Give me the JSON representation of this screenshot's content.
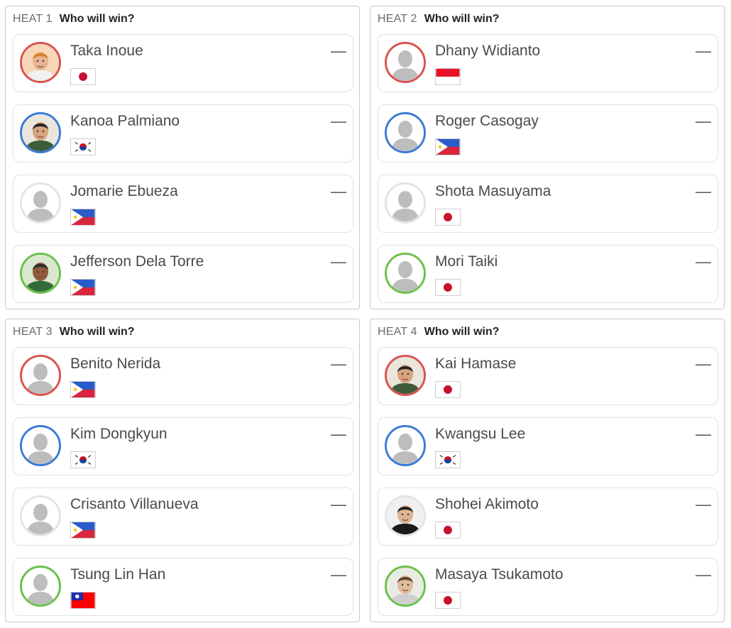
{
  "heats": [
    {
      "label": "HEAT 1",
      "question": "Who will win?",
      "surfers": [
        {
          "name": "Taka Inoue",
          "flag": "japan",
          "ring": "#d9534f",
          "photo": "orange-hair-face",
          "score": "—"
        },
        {
          "name": "Kanoa Palmiano",
          "flag": "korea",
          "ring": "#3a7bd5",
          "photo": "dark-hair-face",
          "score": "—"
        },
        {
          "name": "Jomarie Ebueza",
          "flag": "philippines",
          "ring": "#e4e4e4",
          "photo": "placeholder",
          "score": "—"
        },
        {
          "name": "Jefferson Dela Torre",
          "flag": "philippines",
          "ring": "#6cc04a",
          "photo": "dark-skin-face",
          "score": "—"
        }
      ]
    },
    {
      "label": "HEAT 2",
      "question": "Who will win?",
      "surfers": [
        {
          "name": "Dhany Widianto",
          "flag": "indonesia",
          "ring": "#d9534f",
          "photo": "placeholder",
          "score": "—"
        },
        {
          "name": "Roger Casogay",
          "flag": "philippines",
          "ring": "#3a7bd5",
          "photo": "placeholder",
          "score": "—"
        },
        {
          "name": "Shota Masuyama",
          "flag": "japan",
          "ring": "#e4e4e4",
          "photo": "placeholder",
          "score": "—"
        },
        {
          "name": "Mori Taiki",
          "flag": "japan",
          "ring": "#6cc04a",
          "photo": "placeholder",
          "score": "—"
        }
      ]
    },
    {
      "label": "HEAT 3",
      "question": "Who will win?",
      "surfers": [
        {
          "name": "Benito Nerida",
          "flag": "philippines",
          "ring": "#d9534f",
          "photo": "placeholder",
          "score": "—"
        },
        {
          "name": "Kim Dongkyun",
          "flag": "korea",
          "ring": "#3a7bd5",
          "photo": "placeholder",
          "score": "—"
        },
        {
          "name": "Crisanto Villanueva",
          "flag": "philippines",
          "ring": "#e4e4e4",
          "photo": "placeholder",
          "score": "—"
        },
        {
          "name": "Tsung Lin Han",
          "flag": "taiwan",
          "ring": "#6cc04a",
          "photo": "placeholder",
          "score": "—"
        }
      ]
    },
    {
      "label": "HEAT 4",
      "question": "Who will win?",
      "surfers": [
        {
          "name": "Kai Hamase",
          "flag": "japan",
          "ring": "#d9534f",
          "photo": "dark-hair-face",
          "score": "—"
        },
        {
          "name": "Kwangsu Lee",
          "flag": "korea",
          "ring": "#3a7bd5",
          "photo": "placeholder",
          "score": "—"
        },
        {
          "name": "Shohei Akimoto",
          "flag": "japan",
          "ring": "#e4e4e4",
          "photo": "long-hair-face",
          "score": "—"
        },
        {
          "name": "Masaya Tsukamoto",
          "flag": "japan",
          "ring": "#6cc04a",
          "photo": "light-face",
          "score": "—"
        }
      ]
    }
  ]
}
